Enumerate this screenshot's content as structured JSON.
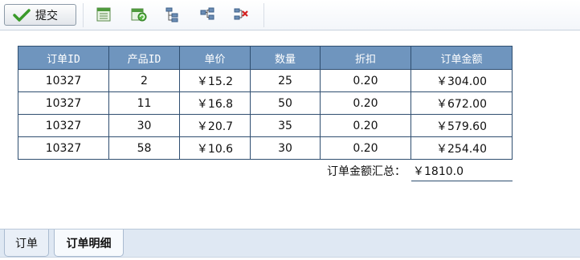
{
  "toolbar": {
    "submit_label": "提交",
    "icons": [
      "excel-export-icon",
      "excel-refresh-icon",
      "tree-structure-icon",
      "tree-add-icon",
      "tree-delete-icon"
    ]
  },
  "table": {
    "headers": [
      "订单ID",
      "产品ID",
      "单价",
      "数量",
      "折扣",
      "订单金额"
    ],
    "rows": [
      [
        "10327",
        "2",
        "￥15.2",
        "25",
        "0.20",
        "￥304.00"
      ],
      [
        "10327",
        "11",
        "￥16.8",
        "50",
        "0.20",
        "￥672.00"
      ],
      [
        "10327",
        "30",
        "￥20.7",
        "35",
        "0.20",
        "￥579.60"
      ],
      [
        "10327",
        "58",
        "￥10.6",
        "30",
        "0.20",
        "￥254.40"
      ]
    ]
  },
  "summary": {
    "label": "订单金额汇总：",
    "value": "￥1810.0"
  },
  "tabs": [
    {
      "label": "订单",
      "active": false
    },
    {
      "label": "订单明细",
      "active": true
    }
  ],
  "colors": {
    "header_bg": "#6f95be",
    "border": "#2f4e70",
    "tabbar_bg": "#dfe8f3"
  }
}
